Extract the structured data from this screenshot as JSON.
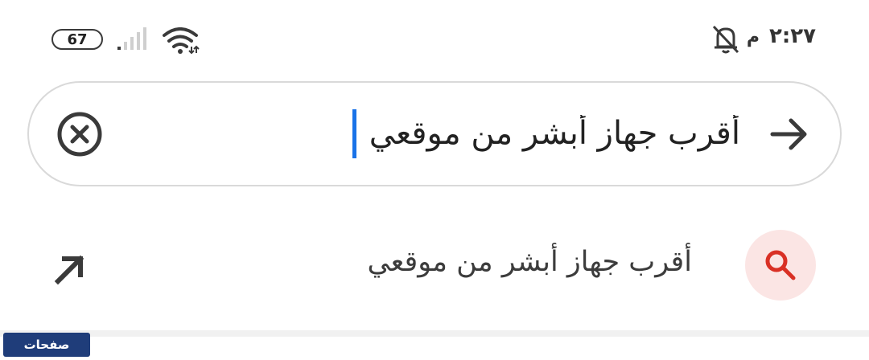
{
  "status_bar": {
    "battery": "67",
    "time": "٢:٢٧",
    "ampm": "م",
    "icons": [
      "signal-icon",
      "wifi-icon",
      "bell-off-icon"
    ]
  },
  "search": {
    "query": "أقرب جهاز أبشر من موقعي",
    "clear_icon": "clear-icon",
    "go_icon": "arrow-right-icon"
  },
  "suggestions": [
    {
      "text": "أقرب جهاز أبشر من موقعي",
      "icon": "search-icon",
      "action_icon": "fill-arrow-icon"
    }
  ],
  "watermark": {
    "text": "صفحات"
  },
  "colors": {
    "caret": "#1a73e8",
    "suggestion_icon_bg": "#fbe5e4",
    "suggestion_icon": "#d93025",
    "border": "#d9d9d9"
  }
}
